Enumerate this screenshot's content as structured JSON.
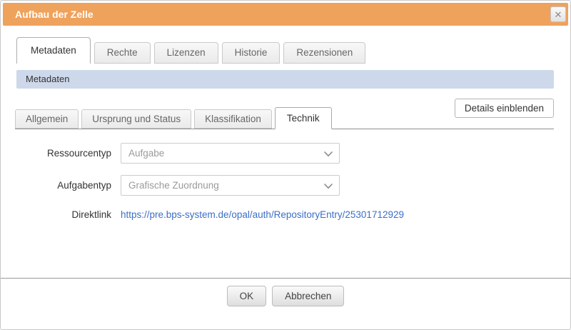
{
  "dialog": {
    "title": "Aufbau der Zelle",
    "close_icon": "✕"
  },
  "main_tabs": {
    "items": [
      {
        "label": "Metadaten",
        "active": true
      },
      {
        "label": "Rechte",
        "active": false
      },
      {
        "label": "Lizenzen",
        "active": false
      },
      {
        "label": "Historie",
        "active": false
      },
      {
        "label": "Rezensionen",
        "active": false
      }
    ]
  },
  "section": {
    "header": "Metadaten",
    "details_button_label": "Details einblenden"
  },
  "sub_tabs": {
    "items": [
      {
        "label": "Allgemein",
        "active": false
      },
      {
        "label": "Ursprung und Status",
        "active": false
      },
      {
        "label": "Klassifikation",
        "active": false
      },
      {
        "label": "Technik",
        "active": true
      }
    ]
  },
  "form": {
    "ressourcentyp": {
      "label": "Ressourcentyp",
      "value": "Aufgabe"
    },
    "aufgabentyp": {
      "label": "Aufgabentyp",
      "value": "Grafische Zuordnung"
    },
    "direktlink": {
      "label": "Direktlink",
      "value": "https://pre.bps-system.de/opal/auth/RepositoryEntry/25301712929"
    }
  },
  "footer": {
    "ok_label": "OK",
    "cancel_label": "Abbrechen"
  },
  "colors": {
    "titlebar_orange": "#EFA25B",
    "section_header_blue": "#CDD9EA",
    "link_blue": "#3B6FC7"
  }
}
